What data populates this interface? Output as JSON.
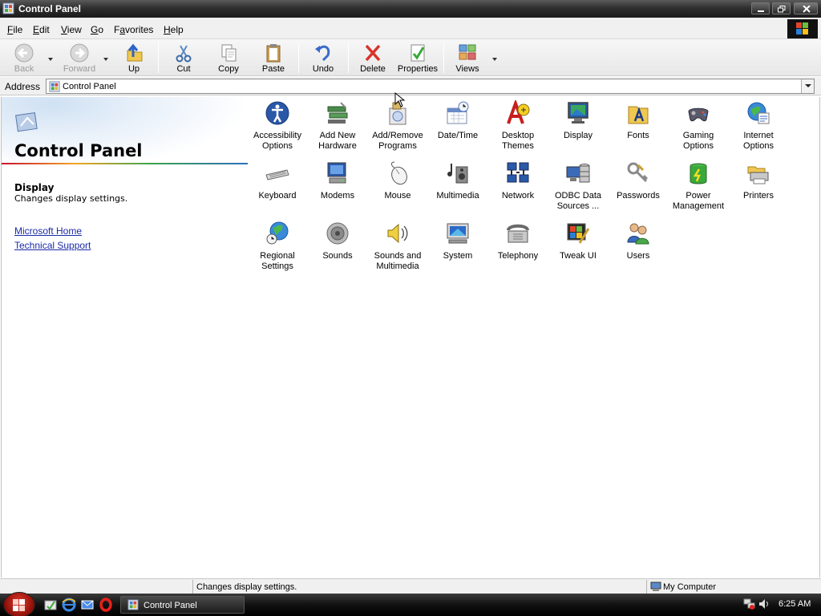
{
  "window": {
    "title": "Control Panel",
    "controls": {
      "minimize": "minimize",
      "restore": "restore",
      "close": "close"
    }
  },
  "menubar": {
    "items": [
      {
        "label": "File",
        "accel": "F",
        "rest": "ile"
      },
      {
        "label": "Edit",
        "accel": "E",
        "rest": "dit"
      },
      {
        "label": "View",
        "accel": "V",
        "rest": "iew"
      },
      {
        "label": "Go",
        "accel": "G",
        "rest": "o"
      },
      {
        "label": "Favorites",
        "accel": "a",
        "prefix": "F",
        "rest": "vorites"
      },
      {
        "label": "Help",
        "accel": "H",
        "rest": "elp"
      }
    ]
  },
  "toolbar": {
    "back": "Back",
    "forward": "Forward",
    "up": "Up",
    "cut": "Cut",
    "copy": "Copy",
    "paste": "Paste",
    "undo": "Undo",
    "delete": "Delete",
    "properties": "Properties",
    "views": "Views"
  },
  "address": {
    "label": "Address",
    "value": "Control Panel"
  },
  "infopane": {
    "title": "Control Panel",
    "selected_name": "Display",
    "selected_desc": "Changes display settings.",
    "links": [
      "Microsoft Home",
      "Technical Support"
    ]
  },
  "items": [
    {
      "line1": "Accessibility",
      "line2": "Options",
      "icon": "accessibility-icon"
    },
    {
      "line1": "Add New",
      "line2": "Hardware",
      "icon": "add-hardware-icon"
    },
    {
      "line1": "Add/Remove",
      "line2": "Programs",
      "icon": "add-remove-programs-icon"
    },
    {
      "line1": "Date/Time",
      "line2": "",
      "icon": "date-time-icon"
    },
    {
      "line1": "Desktop",
      "line2": "Themes",
      "icon": "desktop-themes-icon"
    },
    {
      "line1": "Display",
      "line2": "",
      "icon": "display-icon"
    },
    {
      "line1": "Fonts",
      "line2": "",
      "icon": "fonts-icon"
    },
    {
      "line1": "Gaming",
      "line2": "Options",
      "icon": "gaming-options-icon"
    },
    {
      "line1": "Internet",
      "line2": "Options",
      "icon": "internet-options-icon"
    },
    {
      "line1": "Keyboard",
      "line2": "",
      "icon": "keyboard-icon"
    },
    {
      "line1": "Modems",
      "line2": "",
      "icon": "modems-icon"
    },
    {
      "line1": "Mouse",
      "line2": "",
      "icon": "mouse-icon"
    },
    {
      "line1": "Multimedia",
      "line2": "",
      "icon": "multimedia-icon"
    },
    {
      "line1": "Network",
      "line2": "",
      "icon": "network-icon"
    },
    {
      "line1": "ODBC Data",
      "line2": "Sources ...",
      "icon": "odbc-icon"
    },
    {
      "line1": "Passwords",
      "line2": "",
      "icon": "passwords-icon"
    },
    {
      "line1": "Power",
      "line2": "Management",
      "icon": "power-management-icon"
    },
    {
      "line1": "Printers",
      "line2": "",
      "icon": "printers-icon"
    },
    {
      "line1": "Regional",
      "line2": "Settings",
      "icon": "regional-settings-icon"
    },
    {
      "line1": "Sounds",
      "line2": "",
      "icon": "sounds-icon"
    },
    {
      "line1": "Sounds and",
      "line2": "Multimedia",
      "icon": "sounds-multimedia-icon"
    },
    {
      "line1": "System",
      "line2": "",
      "icon": "system-icon"
    },
    {
      "line1": "Telephony",
      "line2": "",
      "icon": "telephony-icon"
    },
    {
      "line1": "Tweak UI",
      "line2": "",
      "icon": "tweak-ui-icon"
    },
    {
      "line1": "Users",
      "line2": "",
      "icon": "users-icon"
    }
  ],
  "statusbar": {
    "message": "Changes display settings.",
    "zone": "My Computer"
  },
  "taskbar": {
    "task_label": "Control Panel",
    "clock": "6:25 AM"
  },
  "colors": {
    "link": "#1a2aa8",
    "start_button": "#c8281c"
  }
}
